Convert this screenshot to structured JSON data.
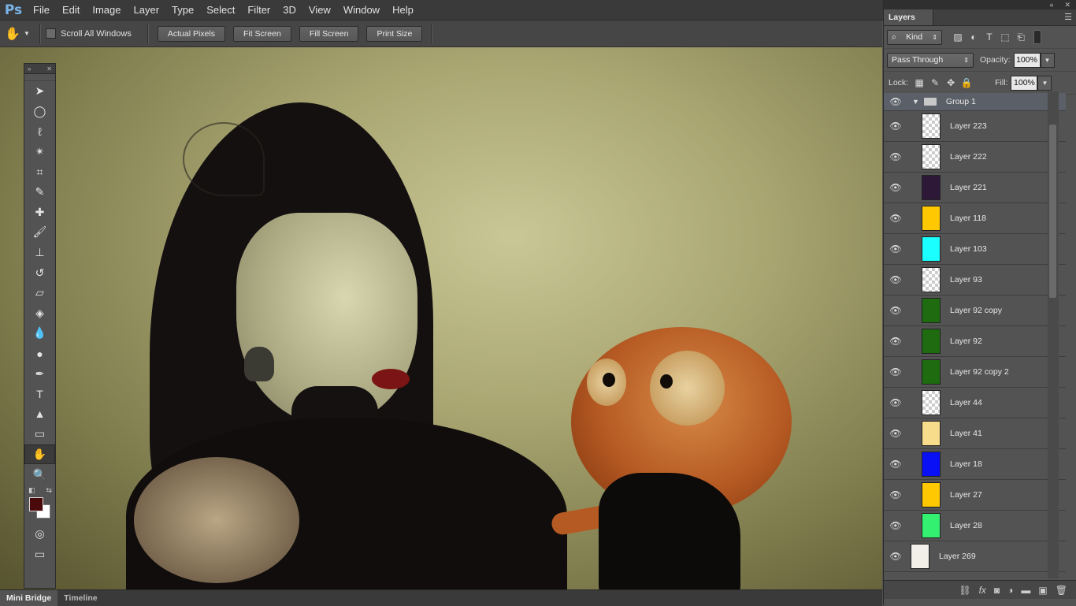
{
  "app": {
    "logo": "Ps"
  },
  "menu": [
    "File",
    "Edit",
    "Image",
    "Layer",
    "Type",
    "Select",
    "Filter",
    "3D",
    "View",
    "Window",
    "Help"
  ],
  "window_controls": {
    "minimize": "–",
    "close": "✕"
  },
  "options": {
    "tool_icon": "hand-icon",
    "scroll_all_windows": "Scroll All Windows",
    "buttons": [
      "Actual Pixels",
      "Fit Screen",
      "Fill Screen",
      "Print Size"
    ]
  },
  "tools": [
    {
      "name": "move-tool-icon",
      "glyph": "➤"
    },
    {
      "name": "elliptical-marquee-icon",
      "glyph": "◯"
    },
    {
      "name": "lasso-icon",
      "glyph": "ℓ"
    },
    {
      "name": "magic-wand-icon",
      "glyph": "✴"
    },
    {
      "name": "crop-icon",
      "glyph": "⌗"
    },
    {
      "name": "eyedropper-icon",
      "glyph": "✎"
    },
    {
      "name": "healing-brush-icon",
      "glyph": "✚"
    },
    {
      "name": "brush-icon",
      "glyph": "🖌"
    },
    {
      "name": "clone-stamp-icon",
      "glyph": "⊥"
    },
    {
      "name": "history-brush-icon",
      "glyph": "↺"
    },
    {
      "name": "eraser-icon",
      "glyph": "▱"
    },
    {
      "name": "paint-bucket-icon",
      "glyph": "◈"
    },
    {
      "name": "blur-icon",
      "glyph": "💧"
    },
    {
      "name": "dodge-icon",
      "glyph": "●"
    },
    {
      "name": "pen-icon",
      "glyph": "✒"
    },
    {
      "name": "type-tool-icon",
      "glyph": "T"
    },
    {
      "name": "path-selection-icon",
      "glyph": "▲"
    },
    {
      "name": "rectangle-icon",
      "glyph": "▭"
    },
    {
      "name": "hand-tool-icon",
      "glyph": "✋"
    },
    {
      "name": "zoom-icon",
      "glyph": "🔍"
    }
  ],
  "colors": {
    "foreground": "#4a0a0c",
    "background": "#ffffff",
    "accent_group": "#5b5f68"
  },
  "bottom_tabs": [
    "Mini Bridge",
    "Timeline"
  ],
  "layers_panel": {
    "tab": "Layers",
    "filter_kind": "Kind",
    "blend_mode": "Pass Through",
    "opacity_label": "Opacity:",
    "opacity_value": "100%",
    "lock_label": "Lock:",
    "fill_label": "Fill:",
    "fill_value": "100%",
    "group_name": "Group 1",
    "layers": [
      {
        "name": "Layer 223",
        "thumb": "checker"
      },
      {
        "name": "Layer 222",
        "thumb": "checker"
      },
      {
        "name": "Layer 221",
        "thumb": "#2e1838"
      },
      {
        "name": "Layer 118",
        "thumb": "#ffc800"
      },
      {
        "name": "Layer 103",
        "thumb": "#1affff"
      },
      {
        "name": "Layer 93",
        "thumb": "checker"
      },
      {
        "name": "Layer 92 copy",
        "thumb": "#1e6b10"
      },
      {
        "name": "Layer 92",
        "thumb": "#1e6b10"
      },
      {
        "name": "Layer 92 copy 2",
        "thumb": "#1e6b10"
      },
      {
        "name": "Layer 44",
        "thumb": "checker"
      },
      {
        "name": "Layer 41",
        "thumb": "#f7dc8c"
      },
      {
        "name": "Layer 18",
        "thumb": "#0a10f5"
      },
      {
        "name": "Layer 27",
        "thumb": "#ffc800"
      },
      {
        "name": "Layer 28",
        "thumb": "#33f070"
      }
    ],
    "bottom_layer": "Layer 269"
  }
}
